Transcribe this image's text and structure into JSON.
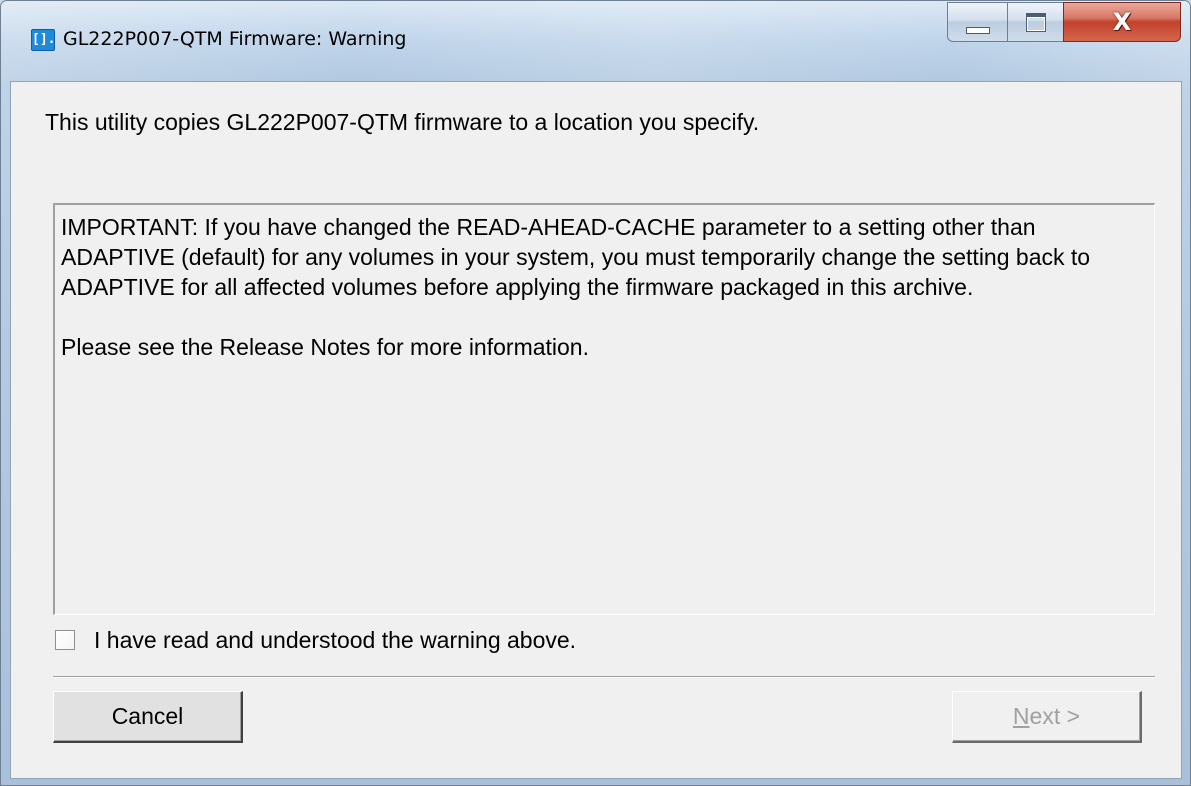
{
  "window": {
    "title": "GL222P007-QTM Firmware: Warning",
    "app_icon_glyph": "[].",
    "icons": {
      "app": "app-icon",
      "minimize": "minimize-icon",
      "maximize": "maximize-icon",
      "close": "close-icon"
    },
    "close_glyph": "X"
  },
  "content": {
    "intro": "This utility copies GL222P007-QTM firmware to a location you specify.",
    "warning_paragraph_1": "IMPORTANT: If you have changed the READ-AHEAD-CACHE parameter to a setting other than ADAPTIVE (default) for any volumes in your system, you must temporarily change the setting back to ADAPTIVE for all affected volumes before applying the firmware packaged in this archive.",
    "warning_paragraph_2": "Please see the Release Notes for more information.",
    "acknowledge_label": "I have read and understood the warning above.",
    "acknowledge_checked": false
  },
  "buttons": {
    "cancel_label": "Cancel",
    "next_accel": "N",
    "next_rest": "ext >",
    "next_enabled": false
  },
  "colors": {
    "close_button": "#c2422c",
    "disabled_text": "#a0a0a0",
    "dialog_background": "#f0f0f0"
  }
}
